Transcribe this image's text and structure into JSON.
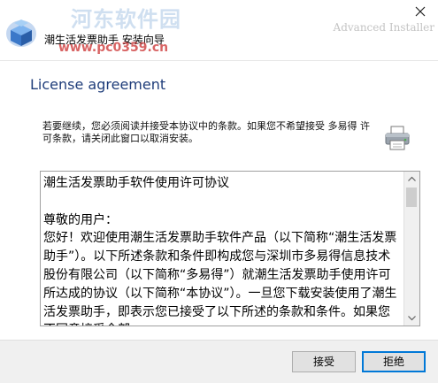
{
  "window": {
    "title": "潮生活发票助手 安装向导",
    "installer_brand": "Advanced Installer",
    "watermark_name": "河东软件园",
    "watermark_url": "www.pc0359.cn"
  },
  "header": {
    "title": "License agreement"
  },
  "instruction": "若要继续，您必须阅读并接受本协议中的条款。如果您不希望接受 多易得 许可条款，请关闭此窗口以取消安装。",
  "license": {
    "text": "潮生活发票助手软件使用许可协议\n\n尊敬的用户：\n您好！欢迎使用潮生活发票助手软件产品（以下简称“潮生活发票助手”）。以下所述条款和条件即构成您与深圳市多易得信息技术股份有限公司（以下简称“多易得”）就潮生活发票助手使用许可所达成的协议（以下简称“本协议”）。一旦您下载安装使用了潮生活发票助手，即表示您已接受了以下所述的条款和条件。如果您不同意接受全部"
  },
  "buttons": {
    "accept": "接受",
    "decline": "拒绝"
  },
  "icons": {
    "app": "box-installer-icon",
    "printer": "printer-icon",
    "close": "close-icon"
  },
  "colors": {
    "title_text": "#1f3d7a",
    "focus_border": "#0078d7"
  }
}
